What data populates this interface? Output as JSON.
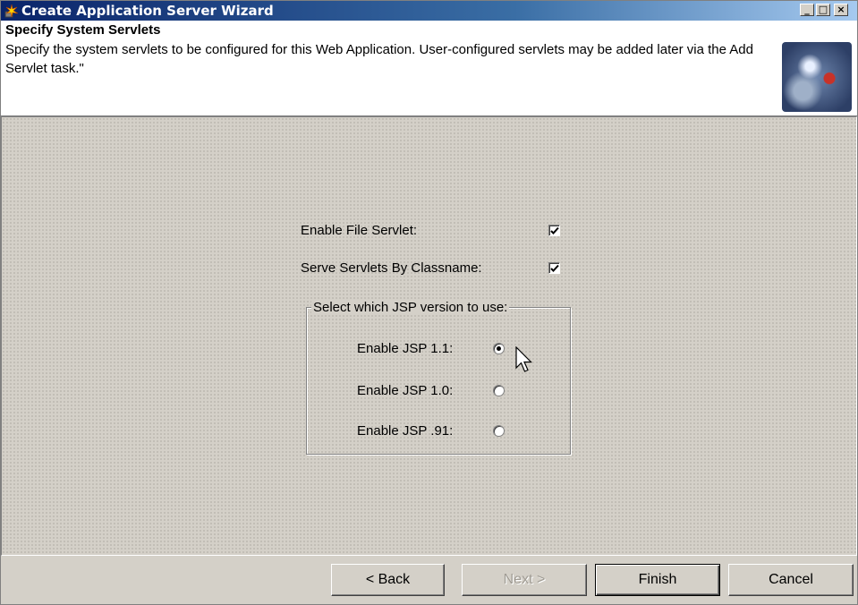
{
  "window": {
    "title": "Create Application Server Wizard",
    "controls": {
      "minimize": "_",
      "maximize": "□",
      "close": "×"
    }
  },
  "header": {
    "title": "Specify System Servlets",
    "description": "Specify the system servlets to be configured for this Web Application.  User-configured servlets may be added later via the Add Servlet task.\""
  },
  "options": {
    "file_servlet": {
      "label": "Enable File Servlet:",
      "checked": true
    },
    "by_classname": {
      "label": "Serve Servlets By Classname:",
      "checked": true
    }
  },
  "jsp_group": {
    "legend": "Select which JSP version to use:",
    "choices": [
      {
        "label": "Enable JSP 1.1:",
        "selected": true
      },
      {
        "label": "Enable JSP 1.0:",
        "selected": false
      },
      {
        "label": "Enable JSP .91:",
        "selected": false
      }
    ]
  },
  "buttons": {
    "back": "< Back",
    "next": "Next >",
    "finish": "Finish",
    "cancel": "Cancel"
  },
  "colors": {
    "title_bar_start": "#0a246a",
    "title_bar_end": "#a6caf0",
    "face": "#d4d0c8",
    "disabled_text": "#a09c94"
  }
}
